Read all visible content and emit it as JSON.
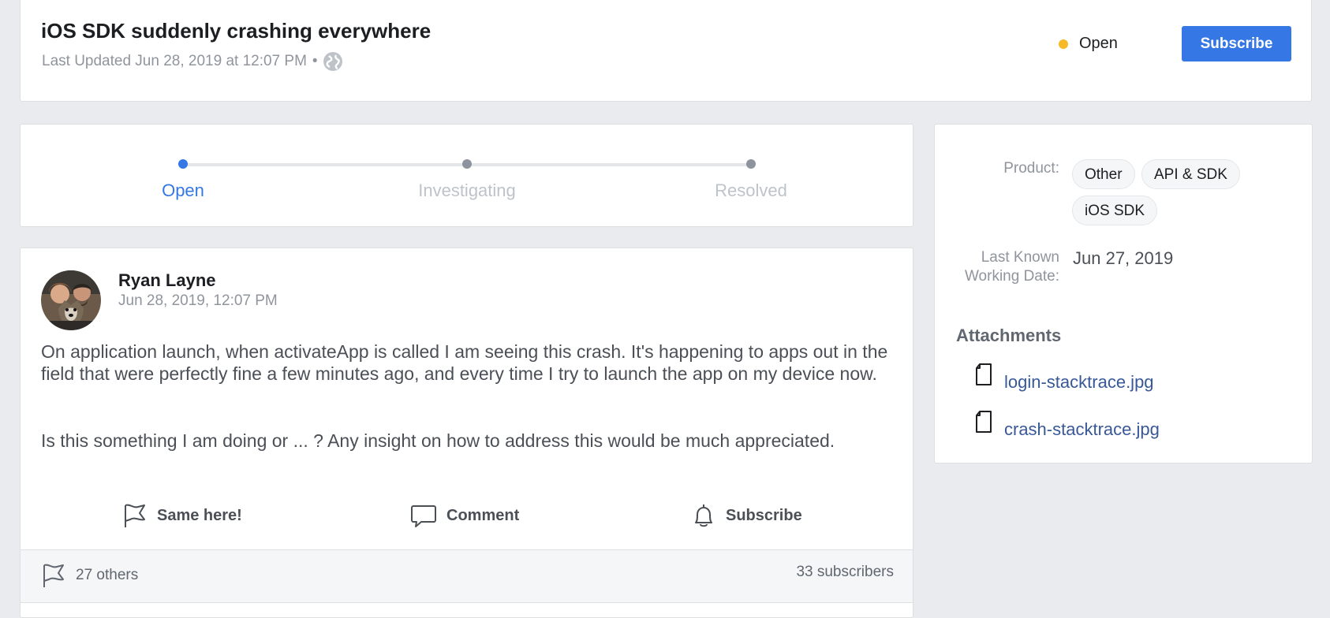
{
  "header": {
    "title": "iOS SDK suddenly crashing everywhere",
    "last_updated": "Last Updated Jun 28, 2019 at 12:07 PM",
    "separator": "•",
    "visibility_icon": "globe-icon",
    "status": "Open",
    "status_color": "#f7b928",
    "subscribe_label": "Subscribe"
  },
  "progress": {
    "steps": [
      {
        "label": "Open",
        "active": true
      },
      {
        "label": "Investigating",
        "active": false
      },
      {
        "label": "Resolved",
        "active": false
      }
    ],
    "active_color": "#3578e5",
    "inactive_color": "#8d949e"
  },
  "post": {
    "author": "Ryan Layne",
    "timestamp": "Jun 28, 2019, 12:07 PM",
    "paragraphs": [
      "On application launch, when activateApp is called I am seeing this crash. It's happening to apps out in the field that were perfectly fine a few minutes ago, and every time I try to launch the app on my device now.",
      "Is this something I am doing or ... ? Any insight on how to address this would be much appreciated."
    ],
    "actions": {
      "same_here": "Same here!",
      "comment": "Comment",
      "subscribe": "Subscribe"
    },
    "footer": {
      "others": "27 others",
      "subscribers": "33 subscribers"
    }
  },
  "sidebar": {
    "product_label": "Product:",
    "product_tags": [
      "Other",
      "API & SDK",
      "iOS SDK"
    ],
    "lkwd_label": "Last Known Working Date:",
    "lkwd_value": "Jun 27, 2019",
    "attachments_heading": "Attachments",
    "attachments": [
      "login-stacktrace.jpg",
      "crash-stacktrace.jpg"
    ]
  },
  "colors": {
    "accent": "#3578e5",
    "link": "#385898",
    "background": "#e9ebee"
  }
}
